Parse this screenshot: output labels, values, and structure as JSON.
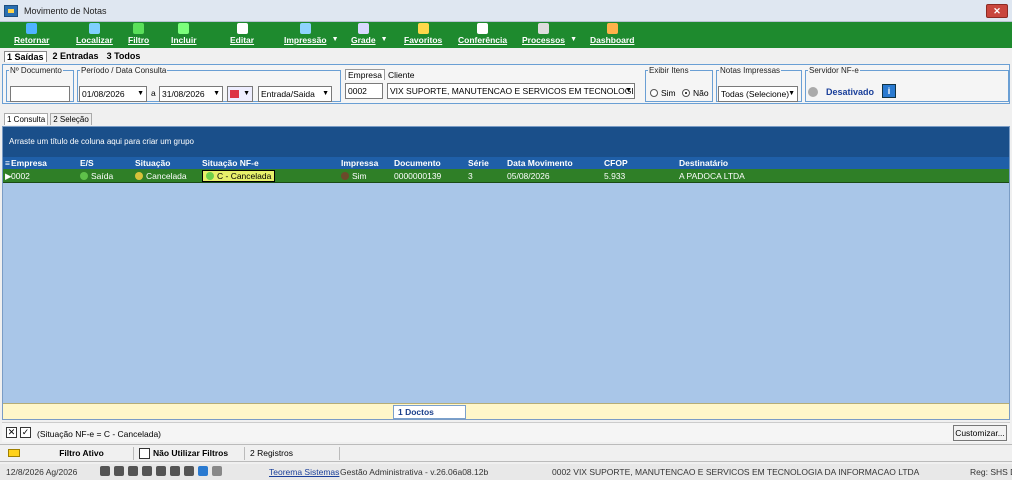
{
  "window": {
    "title": "Movimento de Notas",
    "close_label": "✕"
  },
  "toolbar": [
    {
      "label": "Retornar",
      "icon": "return-icon",
      "color": "#4fb3ff"
    },
    {
      "label": "Localizar",
      "icon": "search-icon",
      "color": "#7fd0ff"
    },
    {
      "label": "Filtro",
      "icon": "filter-icon",
      "color": "#5ae05a"
    },
    {
      "label": "Incluir",
      "icon": "plus-icon",
      "color": "#7cff7c"
    },
    {
      "label": "Editar",
      "icon": "edit-icon",
      "color": "#ffffff"
    },
    {
      "label": "Impressão",
      "icon": "printer-icon",
      "color": "#8fd3ff"
    },
    {
      "label": "Grade",
      "icon": "grid-icon",
      "color": "#d9d9ff"
    },
    {
      "label": "Favoritos",
      "icon": "star-icon",
      "color": "#ffd84a"
    },
    {
      "label": "Conferência",
      "icon": "document-icon",
      "color": "#ffffff"
    },
    {
      "label": "Processos",
      "icon": "gear-icon",
      "color": "#dddddd"
    },
    {
      "label": "Dashboard",
      "icon": "chart-icon",
      "color": "#ffb24a"
    }
  ],
  "tabs": [
    "1 Saídas",
    "2 Entradas",
    "3 Todos"
  ],
  "filters": {
    "nr_documento_label": "Nº Documento",
    "periodo_label": "Período / Data Consulta",
    "date_from": "01/08/2026",
    "date_sep": "a",
    "date_to": "31/08/2026",
    "tipo": "Entrada/Saida",
    "empresa_label": "Empresa",
    "cliente_label": "Cliente",
    "empresa_value": "0002",
    "cliente_value": "VIX SUPORTE, MANUTENCAO E SERVICOS EM TECNOLOGIA",
    "exibir_itens_label": "Exibir Itens",
    "sim_label": "Sim",
    "nao_label": "Não",
    "notas_impressas_label": "Notas Impressas",
    "notas_impressas_value": "Todas (Selecione)",
    "servidor_label": "Servidor NF-e",
    "servidor_status": "Desativado"
  },
  "subtabs": [
    "1 Consulta",
    "2 Seleção"
  ],
  "grid": {
    "group_hint": "Arraste um título de coluna aqui para criar um grupo",
    "columns": [
      "Empresa",
      "E/S",
      "Situação",
      "Situação NF-e",
      "Impressa",
      "Documento",
      "Série",
      "Data Movimento",
      "CFOP",
      "Destinatário"
    ],
    "rows": [
      [
        "0002",
        "Saída",
        "Cancelada",
        "C - Cancelada",
        "Sim",
        "0000000139",
        "3",
        "05/08/2026",
        "5.933",
        "A PADOCA LTDA"
      ]
    ],
    "footer_count": "1 Doctos"
  },
  "filter_bar": {
    "expression": "(Situação NF-e = C - Cancelada)",
    "customize_label": "Customizar..."
  },
  "status_bar": {
    "filtro_ativo": "Filtro Ativo",
    "nao_utilizar": "Não Utilizar Filtros",
    "registros": "2 Registros"
  },
  "bottom_bar": {
    "date": "12/8/2026 Ag/2026",
    "company_link": "Teorema Sistemas",
    "version": "Gestão Administrativa - v.26.06a08.12b",
    "empresa": "0002 VIX SUPORTE, MANUTENCAO E SERVICOS EM TECNOLOGIA DA INFORMACAO LTDA",
    "reg": "Reg: SHS D"
  }
}
